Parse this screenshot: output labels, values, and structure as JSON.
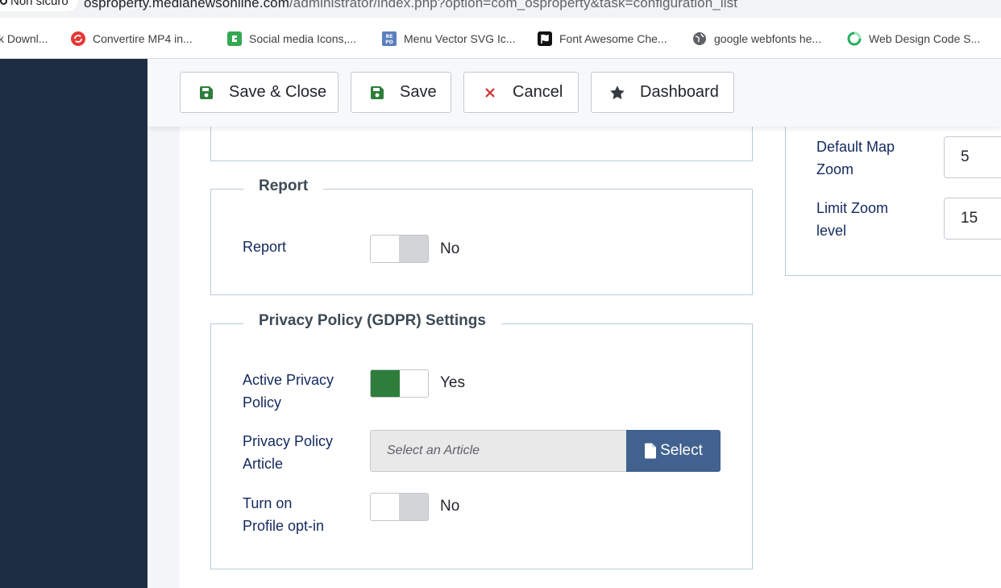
{
  "browser": {
    "security_label": "Non sicuro",
    "url_host": "osproperty.medianewsonline.com",
    "url_path": "/administrator/index.php?option=com_osproperty&task=configuration_list",
    "bookmarks": [
      {
        "label": "k Downl...",
        "icon": "download-icon"
      },
      {
        "label": "Convertire MP4 in...",
        "icon": "convert-icon",
        "color": "#e53935"
      },
      {
        "label": "Social media Icons,...",
        "icon": "social-icon",
        "color": "#34a853"
      },
      {
        "label": "Menu Vector SVG Ic...",
        "icon": "repo-icon",
        "color": "#5b7fbf"
      },
      {
        "label": "Font Awesome Che...",
        "icon": "flag-icon",
        "color": "#111111"
      },
      {
        "label": "google webfonts he...",
        "icon": "globe-icon",
        "color": "#5f6368"
      },
      {
        "label": "Web Design Code S...",
        "icon": "code-icon",
        "color": "#27ae60"
      }
    ]
  },
  "toolbar": {
    "save_close_label": "Save & Close",
    "save_label": "Save",
    "cancel_label": "Cancel",
    "dashboard_label": "Dashboard",
    "accent_green": "#2e7d3b",
    "cancel_red": "#d32f2f"
  },
  "report": {
    "legend": "Report",
    "field_label": "Report",
    "value": "No"
  },
  "privacy": {
    "legend": "Privacy Policy (GDPR) Settings",
    "active_label_1": "Active Privacy",
    "active_label_2": "Policy",
    "active_value": "Yes",
    "article_label_1": "Privacy Policy",
    "article_label_2": "Article",
    "article_placeholder": "Select an Article",
    "select_label": "Select",
    "optin_label_1": "Turn on",
    "optin_label_2": "Profile opt-in",
    "optin_value": "No"
  },
  "map": {
    "zoom_label_1": "Default Map",
    "zoom_label_2": "Zoom",
    "zoom_value": "5",
    "limit_label_1": "Limit Zoom",
    "limit_label_2": "level",
    "limit_value": "15"
  }
}
